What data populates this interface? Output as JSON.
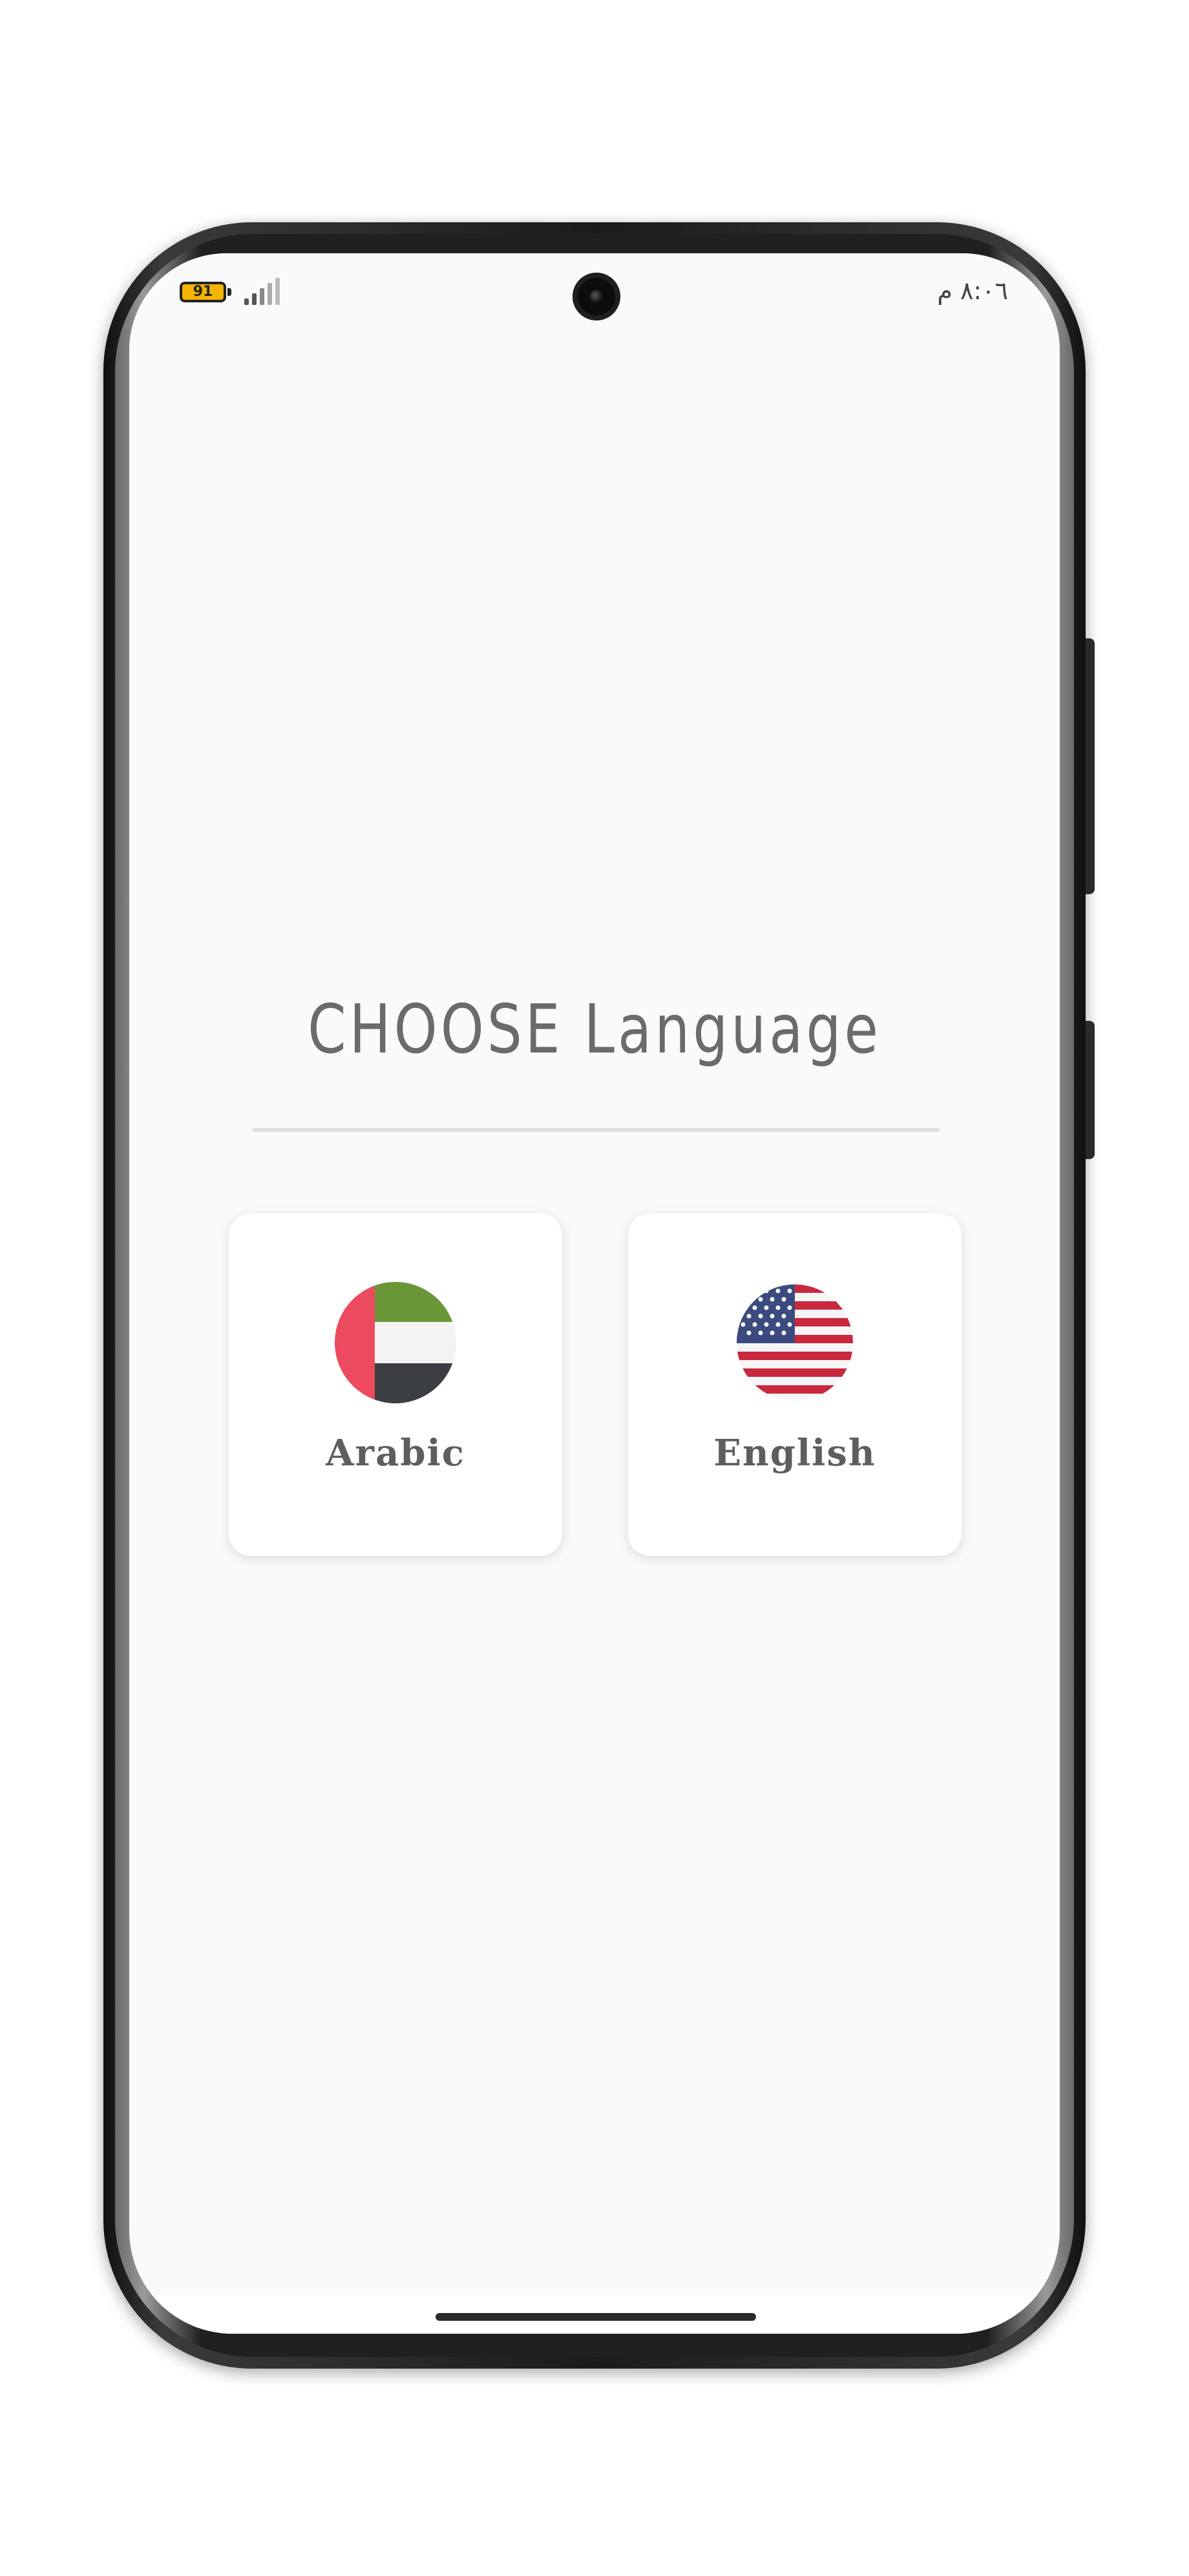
{
  "status_bar": {
    "battery_level": "91",
    "battery_color": "#f4b400",
    "signal_icon": "signal-bars-icon",
    "clock": "٨:٠٦ م"
  },
  "screen": {
    "title": "CHOOSE Language",
    "languages": [
      {
        "label": "Arabic",
        "flag_icon": "uae-flag-icon"
      },
      {
        "label": "English",
        "flag_icon": "usa-flag-icon"
      }
    ]
  },
  "colors": {
    "background": "#fafafa",
    "title": "#6b6b6b",
    "label": "#5e5e5e",
    "divider": "#e0e0e0"
  }
}
